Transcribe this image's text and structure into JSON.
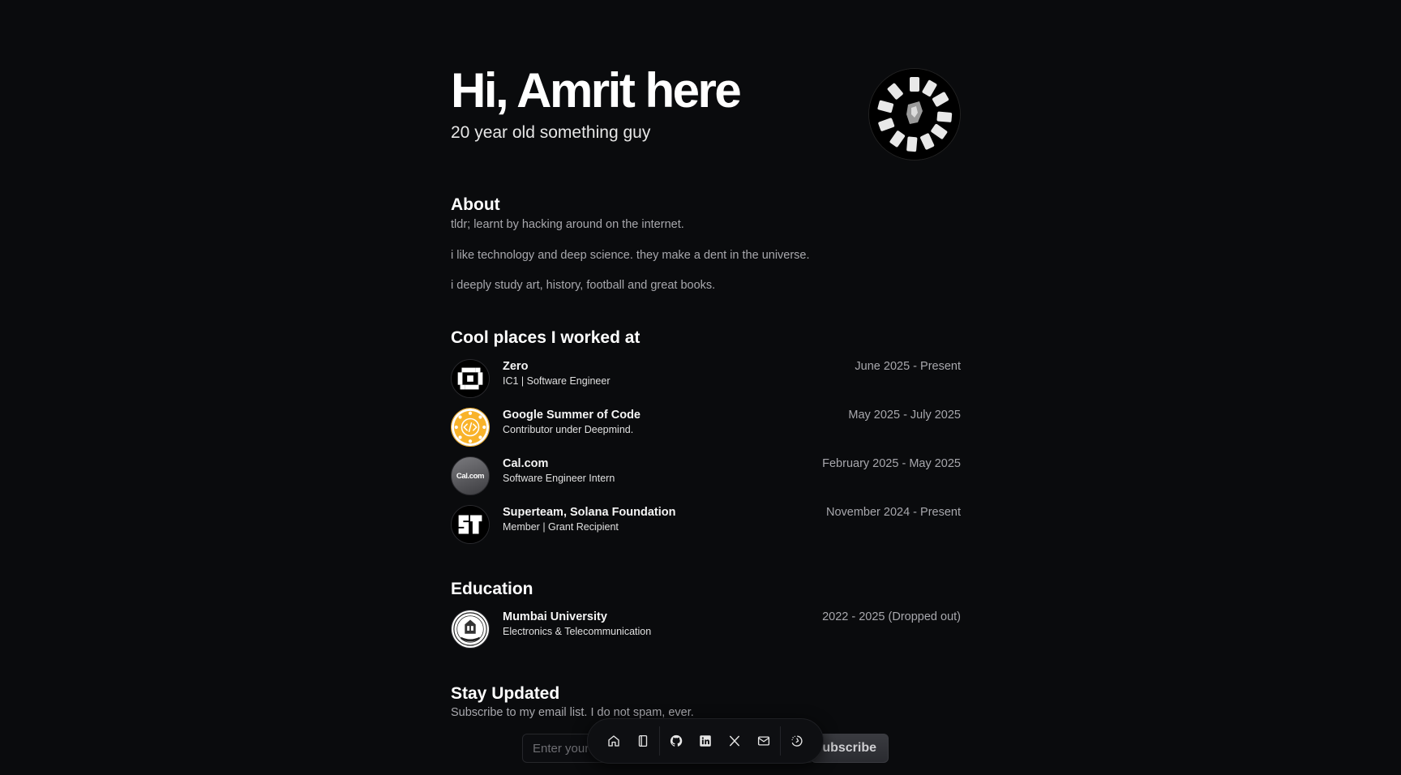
{
  "hero": {
    "title": "Hi, Amrit here",
    "subtitle": "20 year old something guy"
  },
  "about": {
    "heading": "About",
    "paragraphs": [
      "tldr; learnt by hacking around on the internet.",
      "i like technology and deep science. they make a dent in the universe.",
      "i deeply study art, history, football and great books."
    ]
  },
  "work": {
    "heading": "Cool places I worked at",
    "items": [
      {
        "name": "Zero",
        "role": "IC1 | Software Engineer",
        "dates": "June 2025 - Present",
        "logo_icon": "zero-logo-icon"
      },
      {
        "name": "Google Summer of Code",
        "role": "Contributor under Deepmind.",
        "dates": "May 2025 - July 2025",
        "logo_icon": "gsoc-logo-icon"
      },
      {
        "name": "Cal.com",
        "role": "Software Engineer Intern",
        "dates": "February 2025 - May 2025",
        "logo_icon": "calcom-logo-icon",
        "logo_text": "Cal.com"
      },
      {
        "name": "Superteam, Solana Foundation",
        "role": "Member | Grant Recipient",
        "dates": "November 2024 - Present",
        "logo_icon": "superteam-logo-icon"
      }
    ]
  },
  "education": {
    "heading": "Education",
    "items": [
      {
        "name": "Mumbai University",
        "role": "Electronics & Telecommunication",
        "dates": "2022 - 2025 (Dropped out)",
        "logo_icon": "mumbai-university-seal-icon"
      }
    ]
  },
  "newsletter": {
    "heading": "Stay Updated",
    "description": "Subscribe to my email list. I do not spam, ever.",
    "input_placeholder": "Enter your email",
    "button_label": "Subscribe"
  },
  "dock": {
    "items": [
      "home-icon",
      "notebook-icon",
      "github-icon",
      "linkedin-icon",
      "x-icon",
      "mail-icon",
      "theme-toggle-icon"
    ]
  },
  "colors": {
    "background": "#0a0b0d",
    "text_primary": "#ffffff",
    "text_muted": "#a8a8ad",
    "gsoc_yellow": "#f9b32a"
  }
}
